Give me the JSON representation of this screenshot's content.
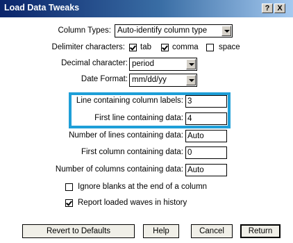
{
  "window": {
    "title": "Load Data Tweaks",
    "help_btn": "?",
    "close_btn": "X"
  },
  "form": {
    "column_types": {
      "label": "Column Types:",
      "value": "Auto-identify column type"
    },
    "delimiters": {
      "label": "Delimiter characters:",
      "tab": {
        "label": "tab",
        "checked": true
      },
      "comma": {
        "label": "comma",
        "checked": true
      },
      "space": {
        "label": "space",
        "checked": false
      }
    },
    "decimal": {
      "label": "Decimal character:",
      "value": "period"
    },
    "date_format": {
      "label": "Date Format:",
      "value": "mm/dd/yy"
    },
    "line_labels": {
      "label": "Line containing column labels:",
      "value": "3"
    },
    "first_line": {
      "label": "First line containing data:",
      "value": "4"
    },
    "num_lines": {
      "label": "Number of lines containing data:",
      "value": "Auto"
    },
    "first_col": {
      "label": "First column containing data:",
      "value": "0"
    },
    "num_cols": {
      "label": "Number of columns containing data:",
      "value": "Auto"
    },
    "ignore_blanks": {
      "label": "Ignore blanks at the end of a column",
      "checked": false
    },
    "report_waves": {
      "label": "Report loaded waves in history",
      "checked": true
    }
  },
  "buttons": {
    "revert": "Revert to Defaults",
    "help": "Help",
    "cancel": "Cancel",
    "return": "Return"
  },
  "colors": {
    "highlight": "#1e9fd8",
    "titlebar": "#0a246a"
  }
}
